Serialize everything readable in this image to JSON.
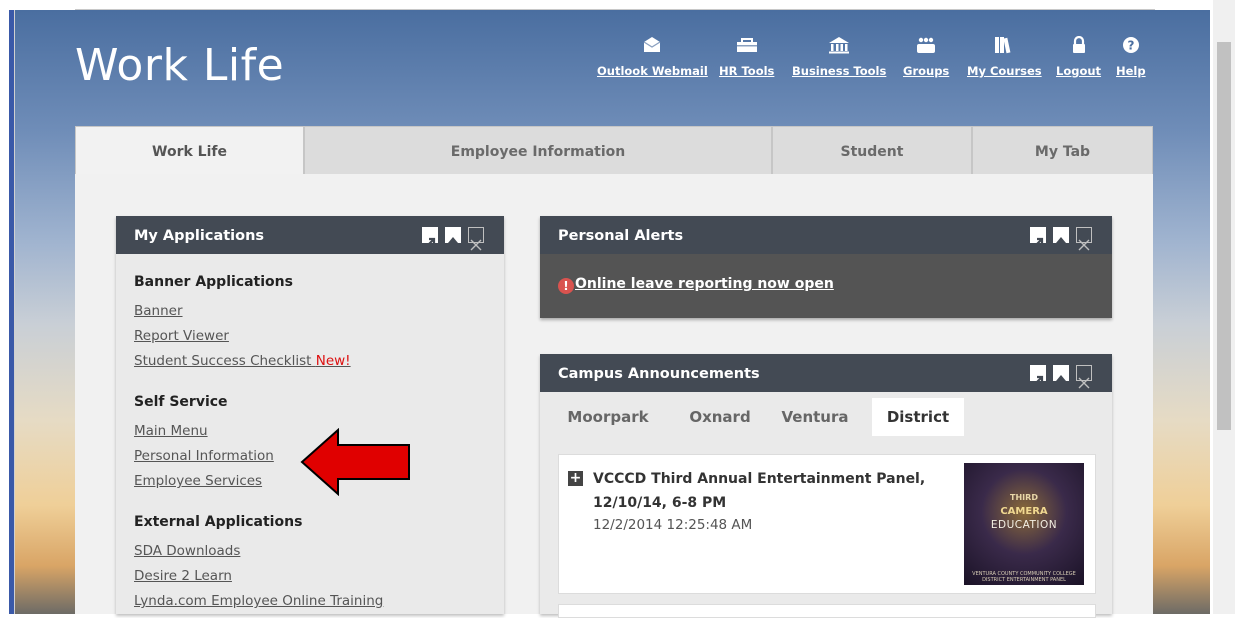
{
  "header": {
    "title": "Work Life",
    "links": [
      {
        "label": "Outlook Webmail",
        "icon": "envelope-icon"
      },
      {
        "label": "HR Tools",
        "icon": "toolbox-icon"
      },
      {
        "label": "Business Tools",
        "icon": "building-icon"
      },
      {
        "label": "Groups",
        "icon": "group-icon"
      },
      {
        "label": "My Courses",
        "icon": "books-icon"
      },
      {
        "label": "Logout",
        "icon": "lock-icon"
      },
      {
        "label": "Help",
        "icon": "help-icon"
      }
    ]
  },
  "tabs": [
    "Work Life",
    "Employee Information",
    "Student",
    "My Tab"
  ],
  "active_tab": "Work Life",
  "my_applications": {
    "title": "My Applications",
    "sections": [
      {
        "heading": "Banner Applications",
        "links": [
          "Banner",
          "Report Viewer",
          "Student Success Checklist"
        ],
        "badge": "New!"
      },
      {
        "heading": "Self Service",
        "links": [
          "Main Menu",
          "Personal Information",
          "Employee Services"
        ]
      },
      {
        "heading": "External Applications",
        "links": [
          "SDA Downloads",
          "Desire 2 Learn",
          "Lynda.com Employee Online Training"
        ]
      }
    ]
  },
  "personal_alerts": {
    "title": "Personal Alerts",
    "message": "Online leave reporting now open"
  },
  "campus_announcements": {
    "title": "Campus Announcements",
    "tabs": [
      "Moorpark",
      "Oxnard",
      "Ventura",
      "District"
    ],
    "active_tab": "District",
    "item": {
      "title": "VCCCD Third Annual Entertainment Panel, 12/10/14, 6-8 PM",
      "date": "12/2/2014 12:25:48 AM",
      "image_text": [
        "THIRD",
        "CAMERA",
        "EDUCATION",
        "VENTURA COUNTY COMMUNITY COLLEGE DISTRICT ENTERTAINMENT PANEL"
      ]
    }
  },
  "colors": {
    "portlet_header": "#434a54",
    "alert_bg": "#545454",
    "badge_new": "#dd1111",
    "arrow": "#e00000"
  }
}
